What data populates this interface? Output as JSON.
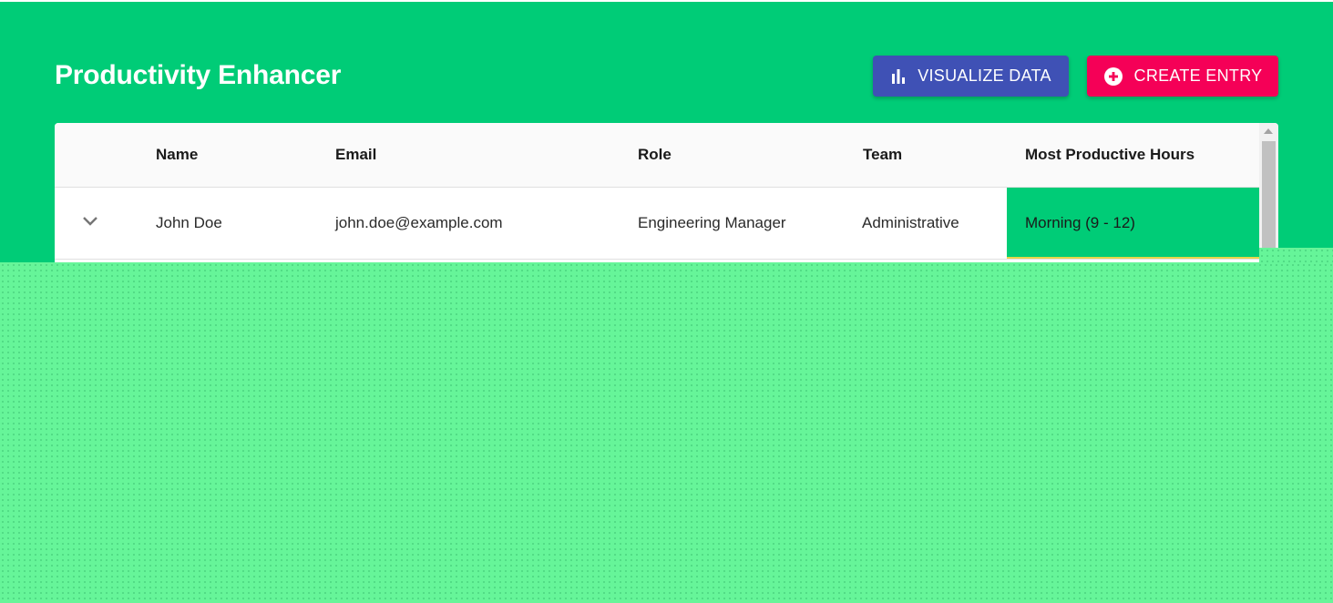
{
  "header": {
    "title": "Productivity Enhancer",
    "visualize_label": "VISUALIZE DATA",
    "visualize_icon": "bar-chart-icon",
    "create_label": "CREATE ENTRY",
    "create_icon": "add-circle-icon"
  },
  "colors": {
    "background": "#00cc77",
    "visualize_button": "#3f51b5",
    "create_button": "#f50057",
    "hours_highlight": "#00cc77",
    "overlay": "#66f599"
  },
  "table": {
    "columns": [
      "Name",
      "Email",
      "Role",
      "Team",
      "Most Productive Hours"
    ],
    "rows": [
      {
        "expand_icon": "chevron-down-icon",
        "name": "John Doe",
        "email": "john.doe@example.com",
        "role": "Engineering Manager",
        "team": "Administrative",
        "hours": "Morning (9 - 12)"
      }
    ]
  }
}
